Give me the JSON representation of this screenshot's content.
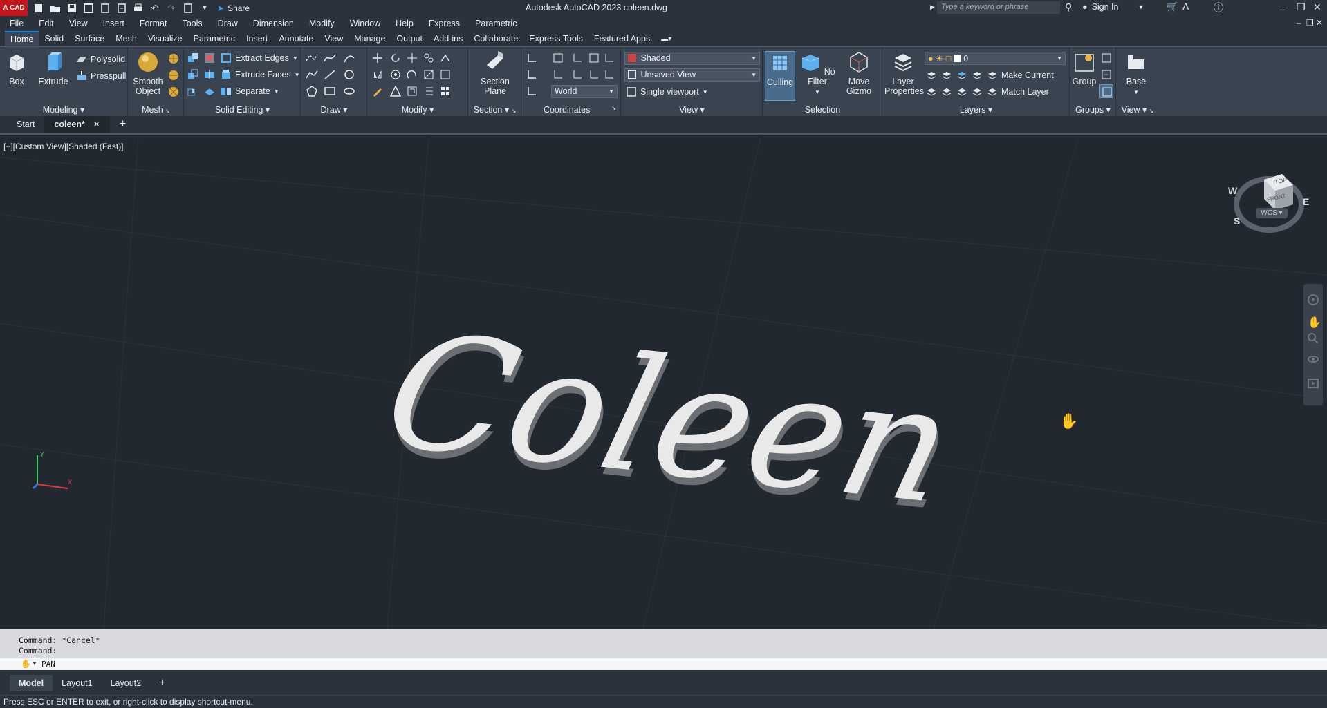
{
  "app": {
    "logo_text": "A CAD",
    "window_title": "Autodesk AutoCAD 2023    coleen.dwg",
    "share_label": "Share",
    "search_placeholder": "Type a keyword or phrase",
    "signin_label": "Sign In"
  },
  "menu": [
    "File",
    "Edit",
    "View",
    "Insert",
    "Format",
    "Tools",
    "Draw",
    "Dimension",
    "Modify",
    "Window",
    "Help",
    "Express",
    "Parametric"
  ],
  "ribbon_tabs": [
    "Home",
    "Solid",
    "Surface",
    "Mesh",
    "Visualize",
    "Parametric",
    "Insert",
    "Annotate",
    "View",
    "Manage",
    "Output",
    "Add-ins",
    "Collaborate",
    "Express Tools",
    "Featured Apps"
  ],
  "ribbon": {
    "modeling": {
      "label": "Modeling",
      "box": "Box",
      "extrude": "Extrude",
      "polysolid": "Polysolid",
      "presspull": "Presspull"
    },
    "mesh": {
      "label": "Mesh",
      "smooth_object": "Smooth Object"
    },
    "solid_editing": {
      "label": "Solid Editing",
      "extract_edges": "Extract Edges",
      "extrude_faces": "Extrude Faces",
      "separate": "Separate"
    },
    "draw": {
      "label": "Draw"
    },
    "modify": {
      "label": "Modify"
    },
    "section": {
      "label": "Section",
      "section_plane": "Section Plane"
    },
    "coordinates": {
      "label": "Coordinates",
      "world": "World"
    },
    "view": {
      "label": "View",
      "visual_style": "Shaded",
      "named_view": "Unsaved View",
      "viewport": "Single viewport"
    },
    "selection": {
      "label": "Selection",
      "culling": "Culling",
      "no_filter": "No Filter",
      "move_gizmo": "Move Gizmo"
    },
    "layers": {
      "label": "Layers",
      "layer_properties": "Layer Properties",
      "current_layer": "0",
      "make_current": "Make Current",
      "match_layer": "Match Layer"
    },
    "groups": {
      "label": "Groups",
      "group": "Group"
    },
    "view2": {
      "label": "View",
      "base": "Base"
    }
  },
  "doc_tabs": {
    "start": "Start",
    "current": "coleen*"
  },
  "viewport": {
    "label": "[−][Custom View][Shaded (Fast)]",
    "model_text": "Coleen",
    "viewcube": {
      "top": "TOP",
      "front": "FRONT",
      "w": "W",
      "e": "E",
      "s": "S",
      "wcs": "WCS"
    }
  },
  "command": {
    "history1": "Command: *Cancel*",
    "history2": "Command:",
    "current": "PAN"
  },
  "layout_tabs": [
    "Model",
    "Layout1",
    "Layout2"
  ],
  "status_text": "Press ESC or ENTER to exit, or right-click to display shortcut-menu."
}
